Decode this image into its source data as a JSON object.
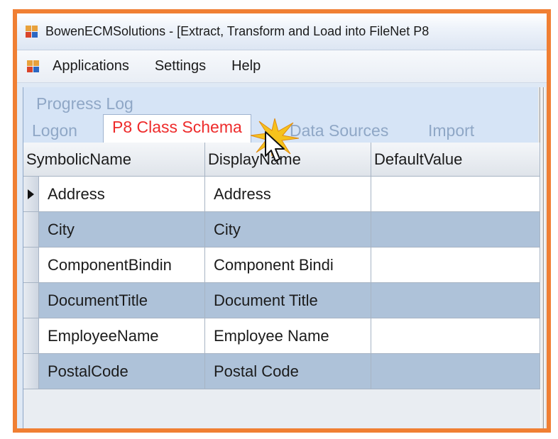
{
  "window": {
    "title": "BowenECMSolutions - [Extract, Transform and Load into FileNet P8"
  },
  "menu": {
    "items": [
      "Applications",
      "Settings",
      "Help"
    ]
  },
  "tabs": {
    "row1": [
      "Progress Log"
    ],
    "row2": [
      "Logon",
      "P8 Class Schema",
      "Data Sources",
      "Import"
    ],
    "active": "P8 Class Schema"
  },
  "grid": {
    "columns": [
      "SymbolicName",
      "DisplayName",
      "DefaultValue"
    ],
    "rows": [
      {
        "symbolic": "Address",
        "display": "Address",
        "default": "",
        "current": true
      },
      {
        "symbolic": "City",
        "display": "City",
        "default": ""
      },
      {
        "symbolic": "ComponentBindin",
        "display": "Component Bindi",
        "default": ""
      },
      {
        "symbolic": "DocumentTitle",
        "display": "Document Title",
        "default": ""
      },
      {
        "symbolic": "EmployeeName",
        "display": "Employee Name",
        "default": ""
      },
      {
        "symbolic": "PostalCode",
        "display": "Postal Code",
        "default": ""
      }
    ]
  },
  "colors": {
    "frame_border": "#f07f33",
    "active_tab_text": "#ee2b2b",
    "inactive_tab_text": "#8fa7c6",
    "alt_row": "#aec2d9"
  },
  "icons": [
    "app-icon",
    "mouse-cursor-icon",
    "click-highlight-icon",
    "row-selector-arrow-icon"
  ]
}
